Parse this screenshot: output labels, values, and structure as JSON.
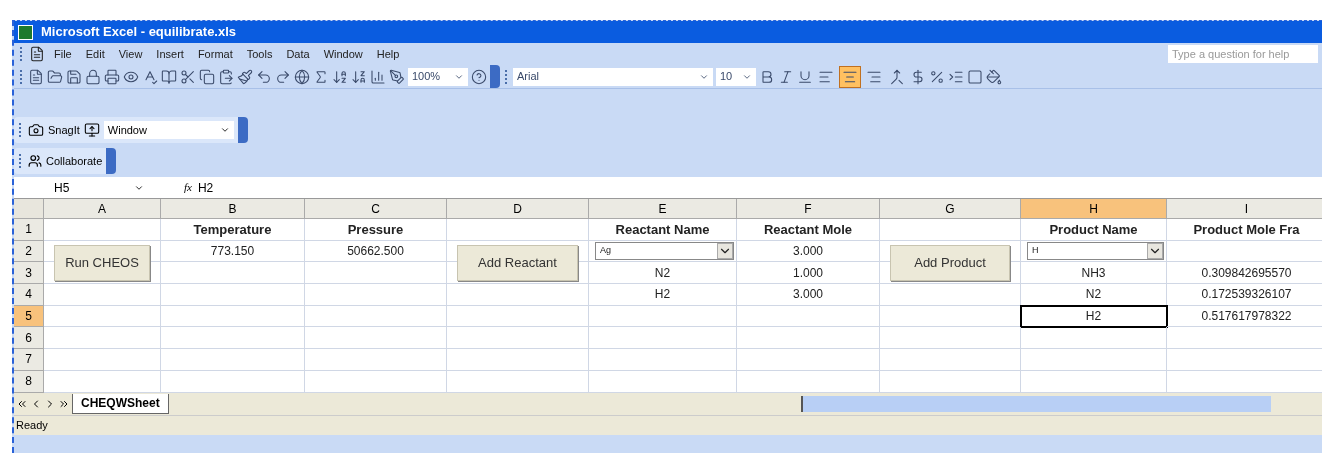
{
  "window": {
    "title": "Microsoft Excel - equilibrate.xls"
  },
  "menu": [
    "File",
    "Edit",
    "View",
    "Insert",
    "Format",
    "Tools",
    "Data",
    "Window",
    "Help"
  ],
  "help_box": {
    "placeholder": "Type a question for help"
  },
  "standard_toolbar": {
    "zoom": "100%"
  },
  "formatting_toolbar": {
    "font": "Arial",
    "size": "10",
    "alignments": [
      {
        "kind": "left",
        "selected": false
      },
      {
        "kind": "center",
        "selected": true
      },
      {
        "kind": "right",
        "selected": false
      },
      {
        "kind": "merge",
        "selected": false
      }
    ]
  },
  "snagit_toolbar": {
    "label": "SnagIt",
    "capture_mode": "Window"
  },
  "collaborate_toolbar": {
    "label": "Collaborate"
  },
  "formula_bar": {
    "name_box": "H5",
    "function_symbol": "fx",
    "formula": "H2"
  },
  "columns": [
    {
      "label": "A",
      "selected": false
    },
    {
      "label": "B",
      "selected": false
    },
    {
      "label": "C",
      "selected": false
    },
    {
      "label": "D",
      "selected": false
    },
    {
      "label": "E",
      "selected": false
    },
    {
      "label": "F",
      "selected": false
    },
    {
      "label": "G",
      "selected": false
    },
    {
      "label": "H",
      "selected": true
    },
    {
      "label": "I",
      "selected": false
    }
  ],
  "rows": [
    {
      "label": "1",
      "selected": false,
      "kind": "header",
      "cells": [
        {},
        {
          "text": "Temperature"
        },
        {
          "text": "Pressure"
        },
        {},
        {
          "text": "Reactant Name"
        },
        {
          "text": "Reactant Mole"
        },
        {},
        {
          "text": "Product Name"
        },
        {
          "text": "Product Mole Fra"
        }
      ]
    },
    {
      "label": "2",
      "selected": false,
      "kind": "data",
      "cells": [
        {
          "kind": "button",
          "text": "Run CHEOS"
        },
        {
          "text": "773.150"
        },
        {
          "text": "50662.500"
        },
        {
          "kind": "button",
          "text": "Add Reactant"
        },
        {
          "kind": "combo",
          "text": "Ag"
        },
        {
          "text": "3.000"
        },
        {
          "kind": "button",
          "text": "Add Product"
        },
        {
          "kind": "combo",
          "text": "H"
        },
        {}
      ]
    },
    {
      "label": "3",
      "selected": false,
      "kind": "data",
      "cells": [
        {},
        {},
        {},
        {},
        {
          "text": "N2"
        },
        {
          "text": "1.000"
        },
        {},
        {
          "text": "NH3"
        },
        {
          "text": "0.309842695570"
        }
      ]
    },
    {
      "label": "4",
      "selected": false,
      "kind": "data",
      "cells": [
        {},
        {},
        {},
        {},
        {
          "text": "H2"
        },
        {
          "text": "3.000"
        },
        {},
        {
          "text": "N2"
        },
        {
          "text": "0.172539326107"
        }
      ]
    },
    {
      "label": "5",
      "selected": true,
      "kind": "data",
      "cells": [
        {},
        {},
        {},
        {},
        {},
        {},
        {},
        {
          "text": "H2"
        },
        {
          "text": "0.517617978322"
        }
      ]
    },
    {
      "label": "6",
      "selected": false,
      "kind": "data",
      "cells": [
        {},
        {},
        {},
        {},
        {},
        {},
        {},
        {},
        {}
      ]
    },
    {
      "label": "7",
      "selected": false,
      "kind": "data",
      "cells": [
        {},
        {},
        {},
        {},
        {},
        {},
        {},
        {},
        {}
      ]
    },
    {
      "label": "8",
      "selected": false,
      "kind": "data",
      "cells": [
        {},
        {},
        {},
        {},
        {},
        {},
        {},
        {},
        {}
      ]
    }
  ],
  "sheet_tabs": [
    {
      "label": "CHEQWSheet",
      "selected": true
    }
  ],
  "status_bar": "Ready"
}
